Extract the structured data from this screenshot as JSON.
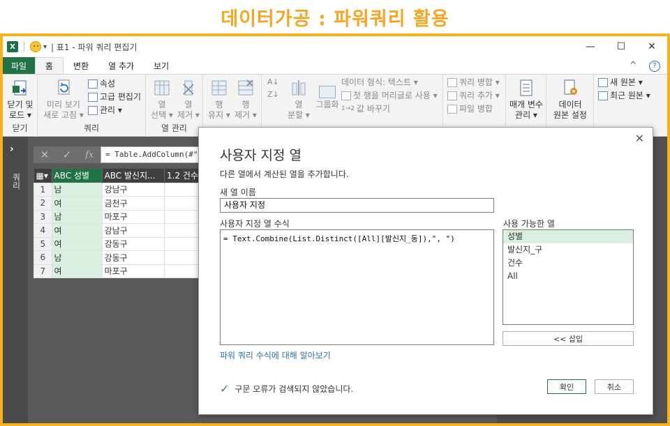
{
  "page_heading": "데이터가공 : 파워쿼리 활용",
  "window": {
    "title": "| 표1 - 파워 쿼리 편집기",
    "app_icon_text": "X",
    "qat_dropdown": "▾",
    "controls": {
      "minimize": "—",
      "maximize": "☐",
      "close": "✕"
    }
  },
  "ribbon_tabs": {
    "file": "파일",
    "items": [
      "홈",
      "변환",
      "열 추가",
      "보기"
    ],
    "right_glyph_1": "^",
    "right_glyph_2": "?"
  },
  "ribbon": {
    "close_group": {
      "btn_line1": "닫기 및",
      "btn_line2": "로드 ▾",
      "label": "닫기"
    },
    "query_group": {
      "refresh_line1": "미리 보기",
      "refresh_line2": "새로 고침 ▾",
      "properties": "속성",
      "advanced_editor": "고급 편집기",
      "manage": "관리 ▾",
      "label": "쿼리"
    },
    "columns_group": {
      "choose_line1": "열",
      "choose_line2": "선택 ▾",
      "remove_line1": "열",
      "remove_line2": "제거 ▾",
      "label": "열 관리"
    },
    "rows_group": {
      "keep_line1": "행",
      "keep_line2": "유지 ▾",
      "remove_line1": "행",
      "remove_line2": "제거 ▾"
    },
    "transform_group": {
      "split_line1": "열",
      "split_line2": "분할 ▾",
      "groupby": "그룹화",
      "data_type": "데이터 형식: 텍스트 ▾",
      "first_row_header": "첫 행을 머리글로 사용 ▾",
      "replace_values": "값 바꾸기"
    },
    "combine_group": {
      "merge_queries": "쿼리 병합 ▾",
      "append_queries": "쿼리 추가 ▾",
      "combine_files": "파일 병합"
    },
    "params_group": {
      "line1": "매개 변수",
      "line2": "관리 ▾"
    },
    "datasource_group": {
      "line1": "데이터",
      "line2": "원본 설정"
    },
    "newquery_group": {
      "new_source": "새 원본 ▾",
      "recent_sources": "최근 원본 ▾"
    }
  },
  "left_panel": {
    "arrow": "›",
    "label": "쿼리"
  },
  "formula_bar": {
    "cancel_glyph": "✕",
    "commit_glyph": "✓",
    "fx_glyph": "fx",
    "text": "= Table.AddColumn(#\""
  },
  "table": {
    "headers": [
      "▦▾",
      "ABC 성별",
      "ABC 발신지...",
      "1.2 건수"
    ],
    "rows": [
      [
        "1",
        "남",
        "강남구",
        ""
      ],
      [
        "2",
        "여",
        "금천구",
        ""
      ],
      [
        "3",
        "남",
        "마포구",
        ""
      ],
      [
        "4",
        "여",
        "강남구",
        ""
      ],
      [
        "5",
        "여",
        "강동구",
        ""
      ],
      [
        "6",
        "남",
        "강동구",
        ""
      ],
      [
        "7",
        "여",
        "마포구",
        ""
      ]
    ]
  },
  "dialog": {
    "title": "사용자 지정 열",
    "description": "다른 열에서 계산된 열을 추가합니다.",
    "new_column_name_label": "새 열 이름",
    "new_column_name_value": "사용자 지정",
    "formula_label": "사용자 지정 열 수식",
    "formula_value": "= Text.Combine(List.Distinct([All][발신지_동]),\", \")",
    "available_columns_label": "사용 가능한 열",
    "available_columns": [
      "성별",
      "발신지_구",
      "건수",
      "All"
    ],
    "selected_column_index": 0,
    "insert_button": "<< 삽입",
    "learn_link": "파워 쿼리 수식에 대해 알아보기",
    "status_text": "구문 오류가 검색되지 않았습니다.",
    "ok_button": "확인",
    "cancel_button": "취소",
    "close_glyph": "✕",
    "check_glyph": "✓"
  },
  "colors": {
    "heading": "#f5a623",
    "frame_border": "#f5b21e",
    "excel_green": "#217346",
    "selected_col_bg": "#d9efdf",
    "link": "#2b6fa8"
  }
}
